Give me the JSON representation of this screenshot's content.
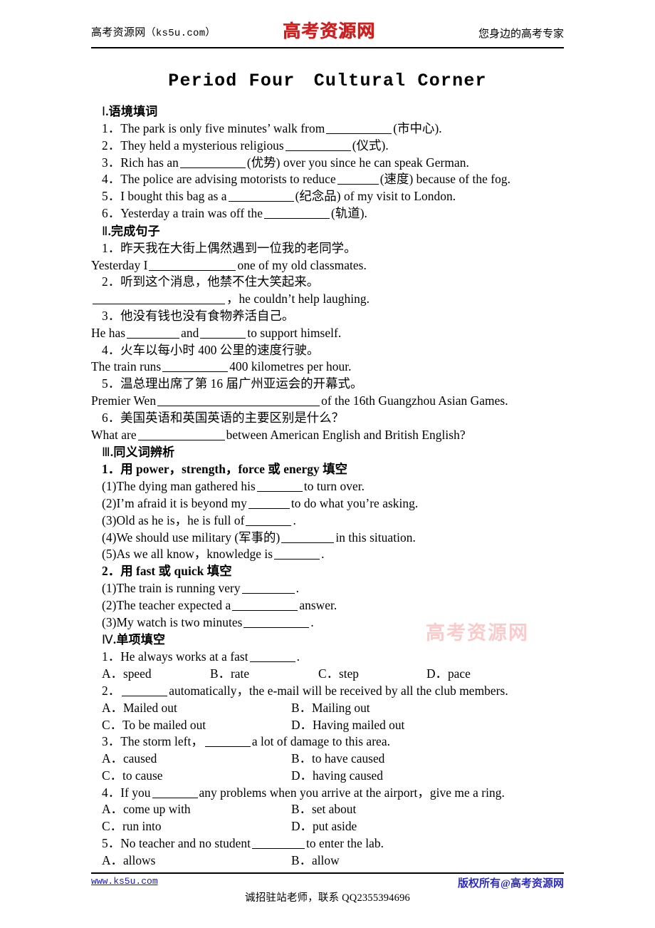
{
  "header": {
    "site_name": "高考资源网",
    "site_domain": "（ks5u.com）",
    "logo": "高考资源网",
    "tagline": "您身边的高考专家"
  },
  "title": "Period Four　Cultural Corner",
  "watermark": "高考资源网",
  "sections": [
    {
      "heading": "Ⅰ.语境填词",
      "roman": "Ⅰ",
      "heading_text": ".语境填词",
      "items": [
        {
          "num": "1．",
          "pre": "The park is only five minutes’ walk from",
          "blank": "b10",
          "post": "(市中心)."
        },
        {
          "num": "2．",
          "pre": "They held a mysterious religious",
          "blank": "b10",
          "post": "(仪式)."
        },
        {
          "num": "3．",
          "pre": "Rich has an",
          "blank": "b10",
          "post": "(优势) over you since he can speak German."
        },
        {
          "num": "4．",
          "pre": "The police are advising motorists to reduce",
          "blank": "b6",
          "post": "(速度) because of the fog."
        },
        {
          "num": "5．",
          "pre": "I bought this bag as a",
          "blank": "b10",
          "post": "(纪念品) of my visit to London."
        },
        {
          "num": "6．",
          "pre": "Yesterday a train was off the",
          "blank": "b10",
          "post": "(轨道)."
        }
      ]
    },
    {
      "heading": "Ⅱ.完成句子",
      "roman": "Ⅱ",
      "heading_text": ".完成句子",
      "items": [
        {
          "cn": "1．昨天我在大街上偶然遇到一位我的老同学。",
          "en_pre": "Yesterday I",
          "blank": "b13",
          "en_post": "one of my old classmates."
        },
        {
          "cn": "2．听到这个消息，他禁不住大笑起来。",
          "en_pre": "",
          "blank": "b20",
          "en_post": "，he couldn’t help laughing."
        },
        {
          "cn": "3．他没有钱也没有食物养活自己。",
          "en_pre": "He has",
          "blank": "b8",
          "en_mid": "and",
          "blank2": "b7",
          "en_post": "to support himself."
        },
        {
          "cn": "4．火车以每小时 400 公里的速度行驶。",
          "en_pre": "The train runs",
          "blank": "b10",
          "en_post": "400 kilometres per hour."
        },
        {
          "cn": "5．温总理出席了第 16 届广州亚运会的开幕式。",
          "en_pre": "Premier Wen",
          "blank": "b24",
          "en_post": "of the 16th Guangzhou Asian Games."
        },
        {
          "cn": "6．美国英语和英国英语的主要区别是什么？",
          "en_pre": "What are",
          "blank": "b13",
          "en_post": "between American English and British English?"
        }
      ]
    },
    {
      "heading": "Ⅲ.同义词辨析",
      "roman": "Ⅲ",
      "heading_text": ".同义词辨析",
      "groups": [
        {
          "prompt_num": "1．",
          "prompt_pre": "用 ",
          "prompt_bold": "power，strength，force",
          "prompt_mid": " 或 ",
          "prompt_bold2": "energy",
          "prompt_post": " 填空",
          "items": [
            {
              "num": "(1)",
              "pre": "The dying man gathered his",
              "blank": "b7",
              "post": "to turn over."
            },
            {
              "num": "(2)",
              "pre": "I’m afraid it is beyond my",
              "blank": "b6",
              "post": "to do what you’re asking."
            },
            {
              "num": "(3)",
              "pre": "Old as he is，he is full of",
              "blank": "b7",
              "post": "."
            },
            {
              "num": "(4)",
              "pre": "We should use military (军事的)",
              "blank": "b8",
              "post": "in this situation."
            },
            {
              "num": "(5)",
              "pre": "As we all know，knowledge is",
              "blank": "b7",
              "post": "."
            }
          ]
        },
        {
          "prompt_num": "2．",
          "prompt_pre": "用 ",
          "prompt_bold": "fast",
          "prompt_mid": " 或 ",
          "prompt_bold2": "quick",
          "prompt_post": " 填空",
          "items": [
            {
              "num": "(1)",
              "pre": "The train is running very",
              "blank": "b8",
              "post": "."
            },
            {
              "num": "(2)",
              "pre": "The teacher expected a",
              "blank": "b10",
              "post": "answer."
            },
            {
              "num": "(3)",
              "pre": "My watch is two minutes",
              "blank": "b10",
              "post": "."
            }
          ]
        }
      ]
    },
    {
      "heading": "Ⅳ.单项填空",
      "roman": "Ⅳ",
      "heading_text": ".单项填空",
      "questions": [
        {
          "num": "1．",
          "stem_pre": "He always works at a fast",
          "blank": "b7",
          "stem_post": ".",
          "layout": "four",
          "options": [
            "A．speed",
            "B．rate",
            "C．step",
            "D．pace"
          ]
        },
        {
          "num": "2．",
          "stem_pre": "",
          "blank": "b7",
          "stem_post": "automatically，the e-mail will be received by all the club members.",
          "layout": "two",
          "options": [
            "A．Mailed out",
            "B．Mailing out",
            "C．To be mailed out",
            "D．Having mailed out"
          ]
        },
        {
          "num": "3．",
          "stem_pre": "The storm left，",
          "blank": "b7",
          "stem_post": "a lot of damage to this area.",
          "layout": "two",
          "options": [
            "A．caused",
            "B．to have caused",
            "C．to cause",
            "D．having caused"
          ]
        },
        {
          "num": "4．",
          "stem_pre": "If you",
          "blank": "b7",
          "stem_post": "any problems when you arrive at the airport，give me a ring.",
          "layout": "two",
          "options": [
            "A．come up with",
            "B．set about",
            "C．run into",
            "D．put aside"
          ]
        },
        {
          "num": "5．",
          "stem_pre": "No teacher and no student",
          "blank": "b8",
          "stem_post": "to enter the lab.",
          "layout": "two",
          "options": [
            "A．allows",
            "B．allow"
          ]
        }
      ]
    }
  ],
  "footer": {
    "url": "www.ks5u.com",
    "copyright": "版权所有@高考资源网",
    "notice": "诚招驻站老师，联系 QQ2355394696"
  }
}
